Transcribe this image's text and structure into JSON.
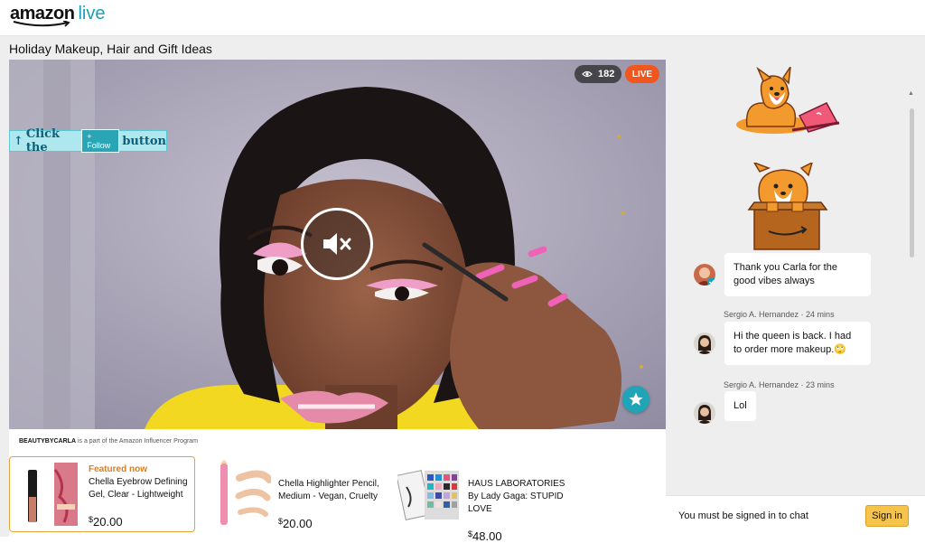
{
  "brand": {
    "name": "amazon",
    "suffix": "live",
    "accent": "#1aa0b3"
  },
  "stream": {
    "title": "Holiday Makeup, Hair and Gift Ideas",
    "viewer_count": "182",
    "live_label": "LIVE",
    "follow_banner": {
      "prefix": "Click the",
      "chip": "+ Follow",
      "suffix": "button"
    },
    "mute_icon": "speaker-muted-icon",
    "favorite_icon": "star-icon",
    "influencer_name": "BEAUTYBYCARLA",
    "influencer_note": " is a part of the Amazon Influencer Program"
  },
  "products": [
    {
      "badge": "Featured now",
      "name": "Chella Eyebrow Defining Gel, Clear - Lightweight",
      "currency": "$",
      "price": "20.00"
    },
    {
      "badge": "",
      "name": "Chella Highlighter Pencil, Medium - Vegan, Cruelty",
      "currency": "$",
      "price": "20.00"
    },
    {
      "badge": "",
      "name": "HAUS LABORATORIES By Lady Gaga: STUPID LOVE",
      "currency": "$",
      "price": "48.00"
    }
  ],
  "chat": {
    "messages": [
      {
        "author": "",
        "text": "Thank you Carla for the good vibes always",
        "verified": true
      },
      {
        "author": "Sergio A. Hernandez · 24 mins",
        "text": "Hi the queen is back. I had to order more makeup.🙄"
      },
      {
        "author": "Sergio A. Hernandez · 23 mins",
        "text": "Lol"
      }
    ],
    "signin_prompt": "You must be signed in to chat",
    "signin_button": "Sign in"
  },
  "colors": {
    "live": "#f0561d",
    "featured_border": "#e3a33a",
    "featured_text": "#e07c17",
    "signin": "#f7c44b"
  }
}
